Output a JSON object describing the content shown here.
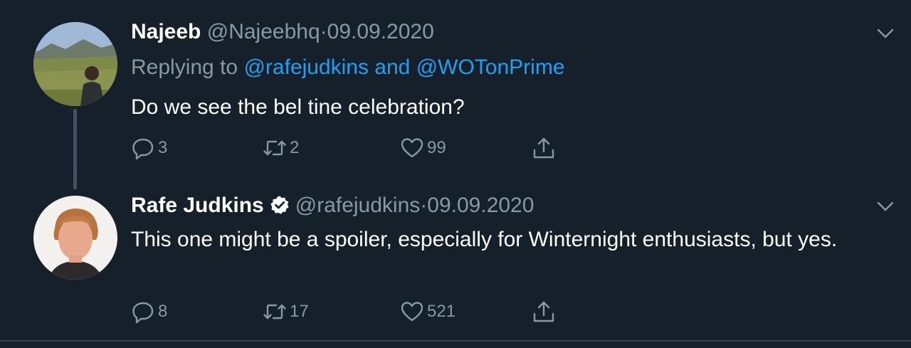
{
  "tweets": [
    {
      "name": "Najeeb",
      "handle": "@Najeebhq",
      "separator": "·",
      "date": "09.09.2020",
      "replying_prefix": "Replying to",
      "replying_to": "@rafejudkins and @WOTonPrime",
      "text": "Do we see the bel tine celebration?",
      "replies": "3",
      "retweets": "2",
      "likes": "99",
      "verified": false
    },
    {
      "name": "Rafe Judkins",
      "handle": "@rafejudkins",
      "separator": "·",
      "date": "09.09.2020",
      "text": "This one might be a spoiler, especially for Winternight enthusiasts, but yes.",
      "replies": "8",
      "retweets": "17",
      "likes": "521",
      "verified": true
    }
  ],
  "colors": {
    "background": "#15202b",
    "text": "#ffffff",
    "muted": "#8899a6",
    "link": "#1da1f2",
    "thread_line": "#3d5466",
    "divider": "#38444d"
  },
  "icons": {
    "reply": "reply-icon",
    "retweet": "retweet-icon",
    "like": "heart-icon",
    "share": "share-icon",
    "more": "chevron-down-icon",
    "verified": "verified-badge-icon"
  }
}
